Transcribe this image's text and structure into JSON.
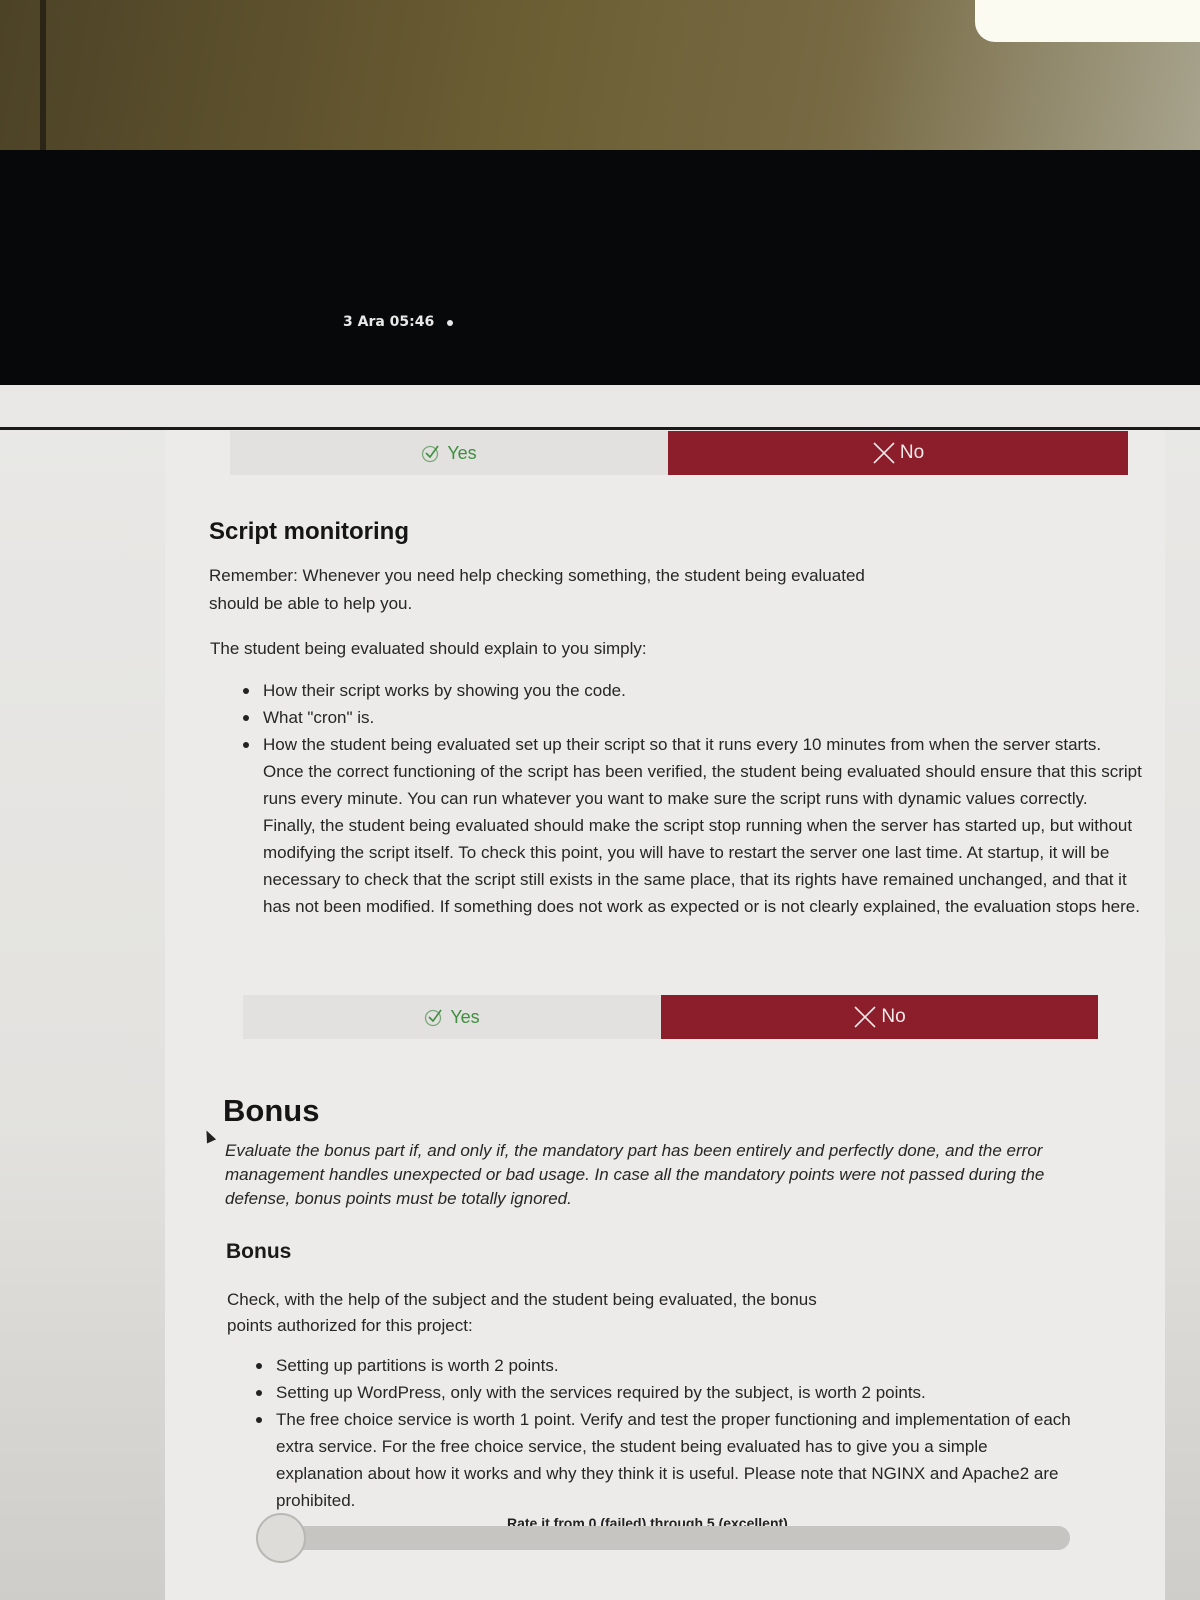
{
  "system_bar": {
    "clock": "3 Ara 05:46"
  },
  "top_choice": {
    "yes_label": "Yes",
    "no_label": "No",
    "selected": "No"
  },
  "script_monitoring": {
    "title": "Script monitoring",
    "remember_line1": "Remember: Whenever you need help checking something, the student being evaluated",
    "remember_line2": "should be able to help you.",
    "intro": "The student being evaluated should explain to you simply:",
    "items": [
      "How their script works by showing you the code.",
      "What \"cron\" is.",
      "How the student being evaluated set up their script so that it runs every 10 minutes from when the server starts. Once the correct functioning of the script has been verified, the student being evaluated should ensure that this script runs every minute. You can run whatever you want to make sure the script runs with dynamic values correctly. Finally, the student being evaluated should make the script stop running when the server has started up, but without modifying the script itself. To check this point, you will have to restart the server one last time. At startup, it will be necessary to check that the script still exists in the same place, that its rights have remained unchanged, and that it has not been modified. If something does not work as expected or is not clearly explained, the evaluation stops here."
    ],
    "yes_label": "Yes",
    "no_label": "No",
    "selected": "No"
  },
  "bonus": {
    "title": "Bonus",
    "description": "Evaluate the bonus part if, and only if, the mandatory part has been entirely and perfectly done, and the error management handles unexpected or bad usage. In case all the mandatory points were not passed during the defense, bonus points must be totally ignored.",
    "subtitle": "Bonus",
    "check_line1": "Check, with the help of the subject and the student being evaluated, the bonus",
    "check_line2": "points authorized for this project:",
    "items": [
      "Setting up partitions is worth 2 points.",
      "Setting up WordPress, only with the services required by the subject, is worth 2 points.",
      "The free choice service is worth 1 point. Verify and test the proper functioning and implementation of each extra service. For the free choice service, the student being evaluated has to give you a simple explanation about how it works and why they think it is useful. Please note that NGINX and Apache2 are prohibited."
    ],
    "rate_label": "Rate it from 0 (failed) through 5 (excellent)",
    "rating": 0
  },
  "colors": {
    "no_selected": "#8c1d2a",
    "yes_text": "#3f8f3f",
    "topbar": "#07080a"
  }
}
